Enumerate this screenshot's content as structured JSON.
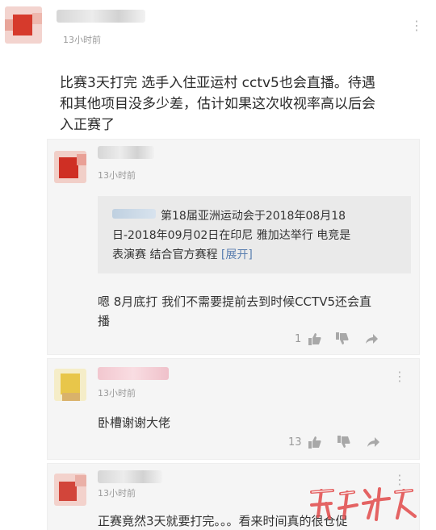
{
  "post": {
    "time": "13小时前",
    "text_line1": "比赛3天打完 选手入住亚运村 cctv5也会直播。待遇",
    "text_line2": "和其他项目没多少差，估计如果这次收视率高以后会",
    "text_line3": "入正赛了"
  },
  "reply1": {
    "time": "13小时前",
    "quote_line1": "第18届亚洲运动会于2018年08月18",
    "quote_line2": "日-2018年09月02日在印尼 雅加达举行 电竞是",
    "quote_line3": "表演赛 结合官方赛程",
    "expand": "[展开]",
    "text_line1": "嗯 8月底打 我们不需要提前去到时候CCTV5还会直",
    "text_line2": "播",
    "likes": "1"
  },
  "reply2": {
    "time": "13小时前",
    "text": "卧槽谢谢大佬",
    "likes": "13"
  },
  "reply3": {
    "time": "13小时前",
    "text": "正赛竟然3天就要打完。。。看来时间真的很仓促"
  },
  "icons": {
    "more": "more-icon",
    "like": "thumbs-up-icon",
    "dislike": "thumbs-down-icon",
    "share": "share-icon"
  },
  "colors": {
    "expand_link": "#5b7fb0",
    "watermark": "#e24a4a"
  }
}
